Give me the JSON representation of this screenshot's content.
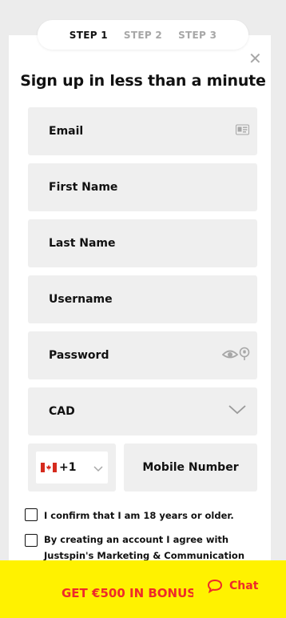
{
  "steps": {
    "step1": "STEP 1",
    "step2": "STEP 2",
    "step3": "STEP 3"
  },
  "close_icon": "close-icon",
  "title": "Sign up in less than a minute",
  "fields": {
    "email": "Email",
    "first_name": "First Name",
    "last_name": "Last Name",
    "username": "Username",
    "password": "Password",
    "currency": "CAD"
  },
  "phone": {
    "country_code": "+1",
    "mobile_placeholder": "Mobile Number"
  },
  "checkboxes": {
    "age_confirm": "I confirm that I am 18 years or older.",
    "marketing_line1": "By creating an account I agree with",
    "marketing_line2": "Justspin's Marketing & Communication"
  },
  "bottom_bar": {
    "bonus": "GET €500 IN BONUS",
    "chat": "Chat"
  },
  "colors": {
    "accent_yellow": "#fff200",
    "accent_red": "#ee2a2a",
    "field_bg": "#efefef",
    "inactive_step": "#a7a7a7"
  }
}
